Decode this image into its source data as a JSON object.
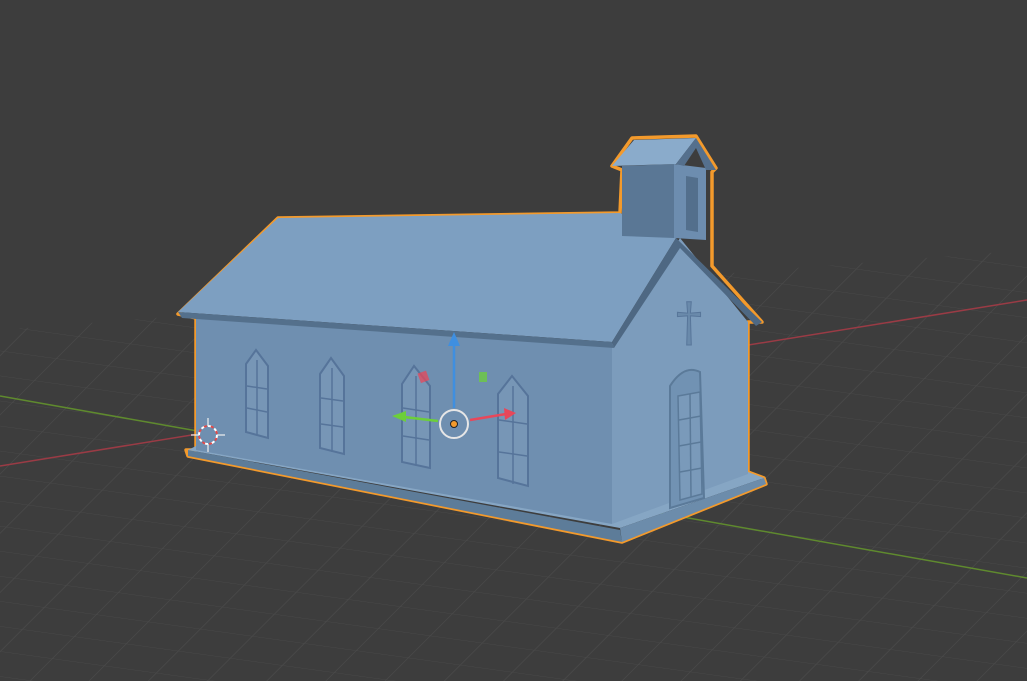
{
  "viewport": {
    "background": "#3d3d3d",
    "grid_color": "#4a4a4a",
    "x_axis_color": "#9a3b45",
    "y_axis_color": "#5f8a2e"
  },
  "scene": {
    "object": "church",
    "object_color": "#7a9cbc",
    "selection_outline_color": "#f39a2c",
    "cross_symbol": "†"
  },
  "gizmo": {
    "x_color": "#e8475a",
    "y_color": "#6ccf3a",
    "z_color": "#3f8fe0",
    "origin_color": "#f39a2c",
    "icons": [
      "move-gizmo-icon",
      "3d-cursor-icon"
    ]
  }
}
